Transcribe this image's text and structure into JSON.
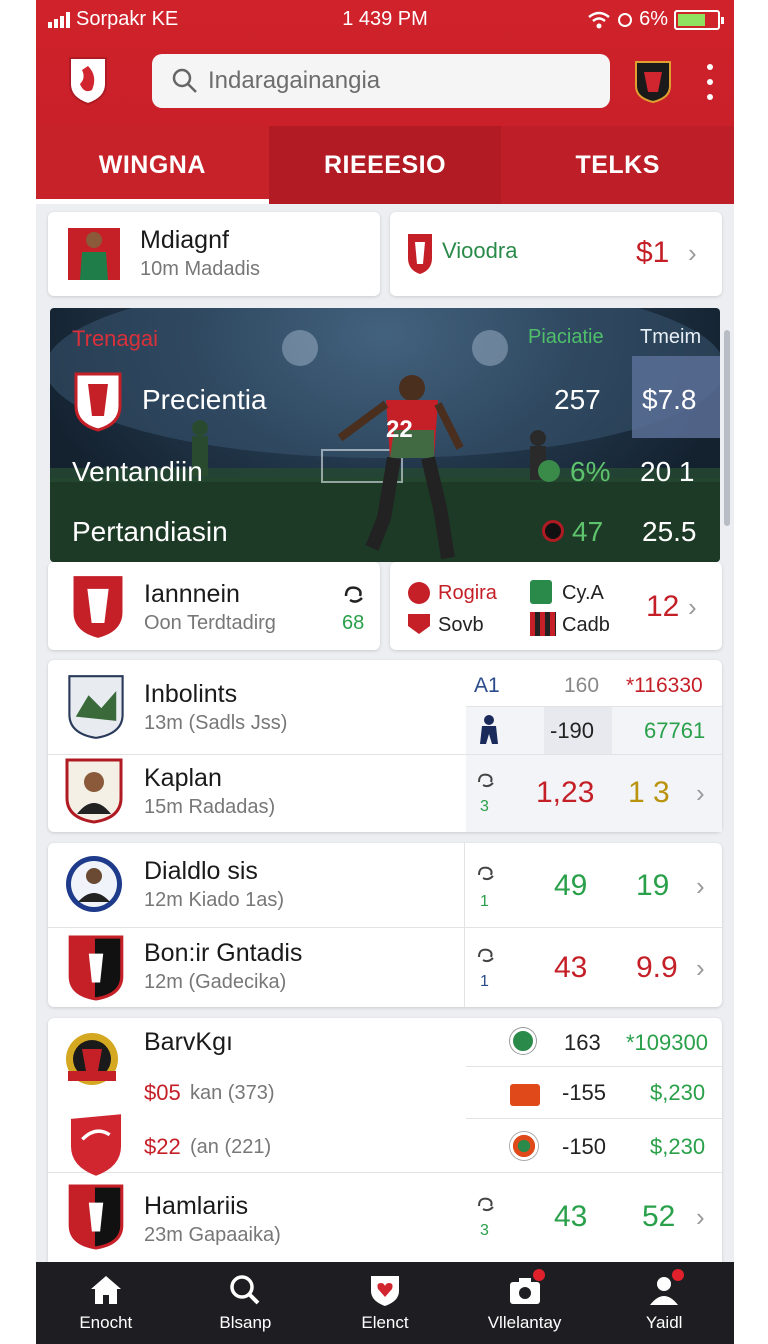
{
  "status_bar": {
    "carrier": "Sorpakr KE",
    "time": "1 439 PM",
    "battery_label": "6%"
  },
  "search": {
    "placeholder": "Indaragainangia"
  },
  "tabs": [
    {
      "label": "WINGNA",
      "active": true
    },
    {
      "label": "RIEEESIO",
      "active": false
    },
    {
      "label": "TELKS",
      "active": false
    }
  ],
  "top_cards": {
    "left": {
      "title": "Mdiagnf",
      "subtitle": "10m Madadis"
    },
    "right": {
      "title": "Vioodra",
      "price": "$1"
    }
  },
  "hero": {
    "label_left": "Trenagai",
    "label_mid": "Piaciatie",
    "label_right": "Tmeim",
    "rows": [
      {
        "name": "Precientia",
        "value1": "257",
        "value2": "$7.8"
      },
      {
        "name": "Ventandiin",
        "value1": "6%",
        "value2": "20 1"
      },
      {
        "name": "Pertandiasin",
        "value1": "47",
        "value2": "25.5"
      }
    ],
    "jersey_number": "22"
  },
  "match_card": {
    "left": {
      "title": "Iannnein",
      "subtitle": "Oon Terdtadirg",
      "score": "68"
    },
    "right": {
      "team1": "Rogira",
      "team2": "Sovb",
      "team3": "Cy.A",
      "team4": "Cadb",
      "value": "12"
    }
  },
  "group1": {
    "header": {
      "col1": "A1",
      "col2": "160",
      "col3": "*116330"
    },
    "rows": [
      {
        "title": "Inbolints",
        "subtitle": "13m (Sadls Jss)",
        "odd1": "-190",
        "odd2": "67761"
      },
      {
        "title": "Kaplan",
        "subtitle": "15m Radadas)",
        "small": "3",
        "odd1": "1,23",
        "odd2": "1 3"
      }
    ]
  },
  "group2": {
    "rows": [
      {
        "title": "Dialdlo sis",
        "subtitle": "12m Kiado 1as)",
        "small": "1",
        "odd1": "49",
        "odd2": "19"
      },
      {
        "title": "Bon:ir Gntadis",
        "subtitle": "12m (Gadecika)",
        "small": "1",
        "odd1": "43",
        "odd2": "9.9"
      }
    ]
  },
  "group3": {
    "rows": [
      {
        "title": "BarvKgı",
        "odd1": "163",
        "odd2": "*109300"
      },
      {
        "price": "$05",
        "detail": "kan (373)",
        "odd1": "-155",
        "odd2": "$,230"
      },
      {
        "price": "$22",
        "detail": "(an (221)",
        "odd1": "-150",
        "odd2": "$,230"
      },
      {
        "title": "Hamlariis",
        "subtitle": "23m Gapaaika)",
        "small": "3",
        "odd1": "43",
        "odd2": "52"
      }
    ]
  },
  "bottom_nav": [
    {
      "label": "Enocht",
      "icon": "home-icon"
    },
    {
      "label": "Blsanp",
      "icon": "search-icon"
    },
    {
      "label": "Elenct",
      "icon": "shield-heart-icon"
    },
    {
      "label": "Vllelantay",
      "icon": "camera-icon"
    },
    {
      "label": "Yaidl",
      "icon": "profile-icon"
    }
  ],
  "colors": {
    "brand_red": "#c51f28",
    "odd_green": "#2aa04a",
    "odd_red": "#c41f27",
    "nav_dark": "#1e1e22"
  }
}
